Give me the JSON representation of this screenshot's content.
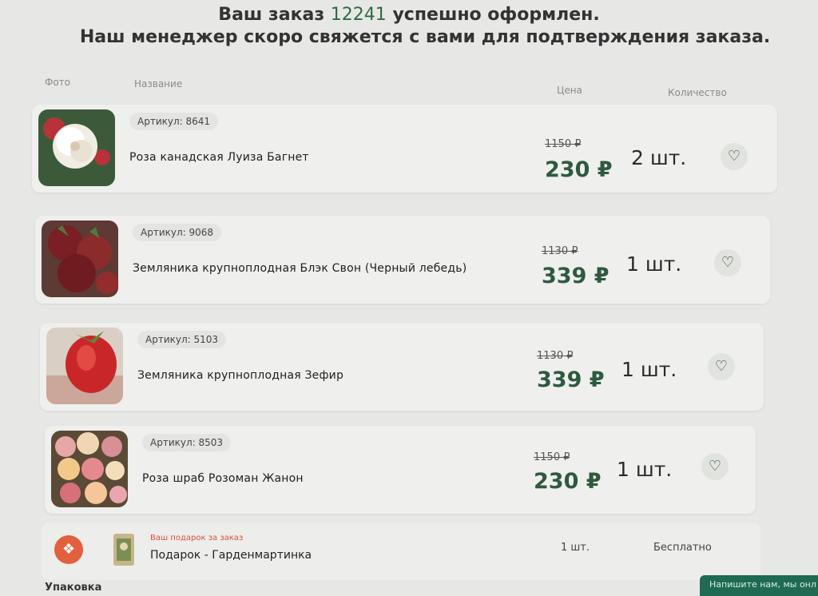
{
  "heading": {
    "line1_prefix": "Ваш заказ",
    "order_number": "12241",
    "line1_suffix": "успешно оформлен.",
    "line2": "Наш менеджер скоро свяжется с вами для подтверждения заказа."
  },
  "columns": {
    "photo": "Фото",
    "name": "Название",
    "price": "Цена",
    "quantity": "Количество"
  },
  "items": [
    {
      "sku": "Артикул: 8641",
      "name": "Роза канадская Луиза Багнет",
      "old_price": "1150 ₽",
      "price": "230 ₽",
      "qty": "2 шт.",
      "favorite_icon": "heart-icon"
    },
    {
      "sku": "Артикул: 9068",
      "name": "Земляника крупноплодная Блэк Свон (Черный лебедь)",
      "old_price": "1130 ₽",
      "price": "339 ₽",
      "qty": "1 шт.",
      "favorite_icon": "heart-icon"
    },
    {
      "sku": "Артикул: 5103",
      "name": "Земляника крупноплодная Зефир",
      "old_price": "1130 ₽",
      "price": "339 ₽",
      "qty": "1 шт.",
      "favorite_icon": "heart-icon"
    },
    {
      "sku": "Артикул: 8503",
      "name": "Роза шраб Розоман Жанон",
      "old_price": "1150 ₽",
      "price": "230 ₽",
      "qty": "1 шт.",
      "favorite_icon": "heart-icon"
    }
  ],
  "gift": {
    "label": "Ваш подарок за заказ",
    "name": "Подарок - Гарденмартинка",
    "qty": "1 шт.",
    "price": "Бесплатно",
    "icon": "gift-icon"
  },
  "packing_label": "Упаковка",
  "chat_button": "Напишите нам, мы онл",
  "colors": {
    "price": "#2e5a3f",
    "order_number": "#2e6b45",
    "gift_accent": "#e2603d",
    "chat_button": "#1f6a52"
  }
}
